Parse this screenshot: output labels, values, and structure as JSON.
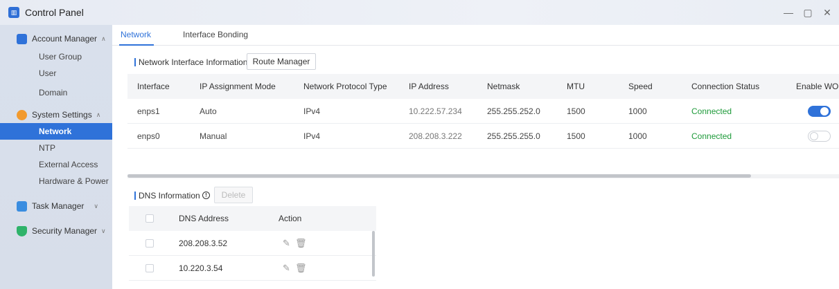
{
  "app": {
    "title": "Control Panel",
    "icon": "control-panel-icon"
  },
  "window_controls": {
    "minimize": "—",
    "restore": "▢",
    "close": "✕"
  },
  "sidebar": {
    "groups": [
      {
        "label": "Account Manager",
        "icon": "account-manager-icon",
        "color": "#2f72d9",
        "items": [
          "User Group",
          "User",
          "Domain"
        ]
      },
      {
        "label": "System Settings",
        "icon": "system-settings-icon",
        "color": "#f29a2e",
        "items": [
          "Network",
          "NTP",
          "External Access",
          "Hardware & Power"
        ],
        "active_item": "Network"
      },
      {
        "label": "Task Manager",
        "icon": "task-manager-icon",
        "color": "#3a8de0",
        "items": []
      },
      {
        "label": "Security Manager",
        "icon": "security-manager-icon",
        "color": "#2fb36a",
        "items": []
      }
    ]
  },
  "tabs": [
    {
      "label": "Network",
      "active": true
    },
    {
      "label": "Interface Bonding",
      "active": false
    }
  ],
  "network_section": {
    "title": "Network Interface Information",
    "route_button": "Route Manager",
    "columns": [
      "Interface",
      "IP Assignment Mode",
      "Network Protocol Type",
      "IP Address",
      "Netmask",
      "MTU",
      "Speed",
      "Connection Status",
      "Enable WOL"
    ],
    "rows": [
      {
        "interface": "enps1",
        "mode": "Auto",
        "protocol": "IPv4",
        "ip": "10.222.57.234",
        "netmask": "255.255.252.0",
        "mtu": "1500",
        "speed": "1000",
        "status": "Connected",
        "wol": true
      },
      {
        "interface": "enps0",
        "mode": "Manual",
        "protocol": "IPv4",
        "ip": "208.208.3.222",
        "netmask": "255.255.255.0",
        "mtu": "1500",
        "speed": "1000",
        "status": "Connected",
        "wol": false
      }
    ]
  },
  "dns_section": {
    "title": "DNS Information",
    "delete_button": "Delete",
    "columns": [
      "DNS Address",
      "Action"
    ],
    "rows": [
      {
        "address": "208.208.3.52"
      },
      {
        "address": "10.220.3.54"
      }
    ]
  },
  "colors": {
    "accent": "#2f72d9",
    "connected": "#1e9a3a"
  }
}
